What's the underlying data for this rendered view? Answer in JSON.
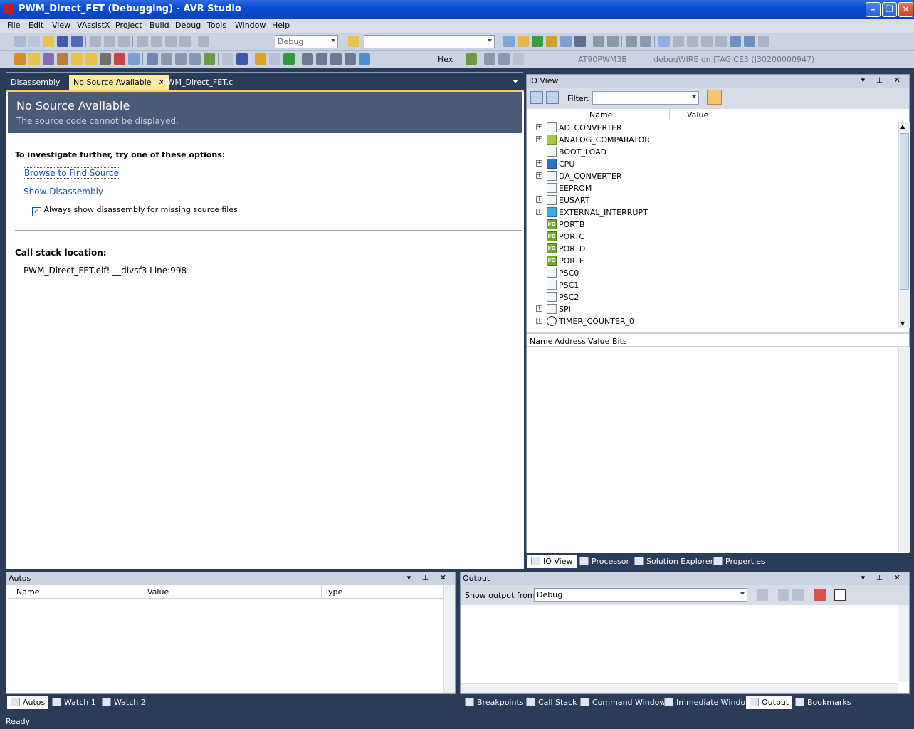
{
  "window": {
    "title": "PWM_Direct_FET (Debugging) - AVR Studio"
  },
  "menu": [
    "File",
    "Edit",
    "View",
    "VAssistX",
    "Project",
    "Build",
    "Debug",
    "Tools",
    "Window",
    "Help"
  ],
  "toolbar": {
    "config_value": "Debug",
    "search_value": "",
    "hex_label": "Hex",
    "device_label": "AT90PWM3B",
    "tool_label": "debugWIRE on JTAGICE3 (J30200000947)"
  },
  "doc_tabs": [
    {
      "label": "Disassembly"
    },
    {
      "label": "No Source Available",
      "close": "✕"
    },
    {
      "label": "PWM_Direct_FET.c"
    }
  ],
  "nsa": {
    "title": "No Source Available",
    "subtitle": "The source code cannot be displayed.",
    "investigate": "To investigate further, try one of these options:",
    "browse_link": "Browse to Find Source",
    "show_disasm_link": "Show Disassembly",
    "always_show_label": "Always show disassembly for missing source files",
    "call_stack_heading": "Call stack location:",
    "call_stack_value": "PWM_Direct_FET.elf! __divsf3 Line:998"
  },
  "io_view": {
    "title": "IO View",
    "filter_label": "Filter:",
    "col_name": "Name",
    "col_value": "Value",
    "items": [
      {
        "label": "AD_CONVERTER",
        "icon": "doc-icon",
        "expandable": "true"
      },
      {
        "label": "ANALOG_COMPARATOR",
        "icon": "adc-icon",
        "expandable": "true"
      },
      {
        "label": "BOOT_LOAD",
        "icon": "doc-icon",
        "expandable": ""
      },
      {
        "label": "CPU",
        "icon": "cpu-icon",
        "expandable": "true"
      },
      {
        "label": "DA_CONVERTER",
        "icon": "doc-icon",
        "expandable": "true"
      },
      {
        "label": "EEPROM",
        "icon": "doc-icon",
        "expandable": ""
      },
      {
        "label": "EUSART",
        "icon": "doc-icon",
        "expandable": "true"
      },
      {
        "label": "EXTERNAL_INTERRUPT",
        "icon": "interrupt-icon",
        "expandable": "true"
      },
      {
        "label": "PORTB",
        "icon": "io-icon",
        "expandable": ""
      },
      {
        "label": "PORTC",
        "icon": "io-icon",
        "expandable": ""
      },
      {
        "label": "PORTD",
        "icon": "io-icon",
        "expandable": ""
      },
      {
        "label": "PORTE",
        "icon": "io-icon",
        "expandable": ""
      },
      {
        "label": "PSC0",
        "icon": "doc-icon",
        "expandable": ""
      },
      {
        "label": "PSC1",
        "icon": "doc-icon",
        "expandable": ""
      },
      {
        "label": "PSC2",
        "icon": "doc-icon",
        "expandable": ""
      },
      {
        "label": "SPI",
        "icon": "doc-icon",
        "expandable": "true"
      },
      {
        "label": "TIMER_COUNTER_0",
        "icon": "timer-icon",
        "expandable": "true"
      }
    ],
    "bits_cols": [
      "Name",
      "Address",
      "Value",
      "Bits"
    ],
    "tabs": [
      "IO View",
      "Processor",
      "Solution Explorer",
      "Properties"
    ]
  },
  "autos": {
    "title": "Autos",
    "cols": [
      "Name",
      "Value",
      "Type"
    ],
    "tabs": [
      "Autos",
      "Watch 1",
      "Watch 2"
    ]
  },
  "output": {
    "title": "Output",
    "show_from_label": "Show output from:",
    "show_from_value": "Debug",
    "tabs": [
      "Breakpoints",
      "Call Stack",
      "Command Window",
      "Immediate Window",
      "Output",
      "Bookmarks"
    ]
  },
  "status": {
    "text": "Ready"
  },
  "colors": {
    "chrome": "#2b3c59",
    "active_tab": "#fde9a0",
    "link": "#1f4fb0",
    "banner": "#4a5b7a"
  }
}
